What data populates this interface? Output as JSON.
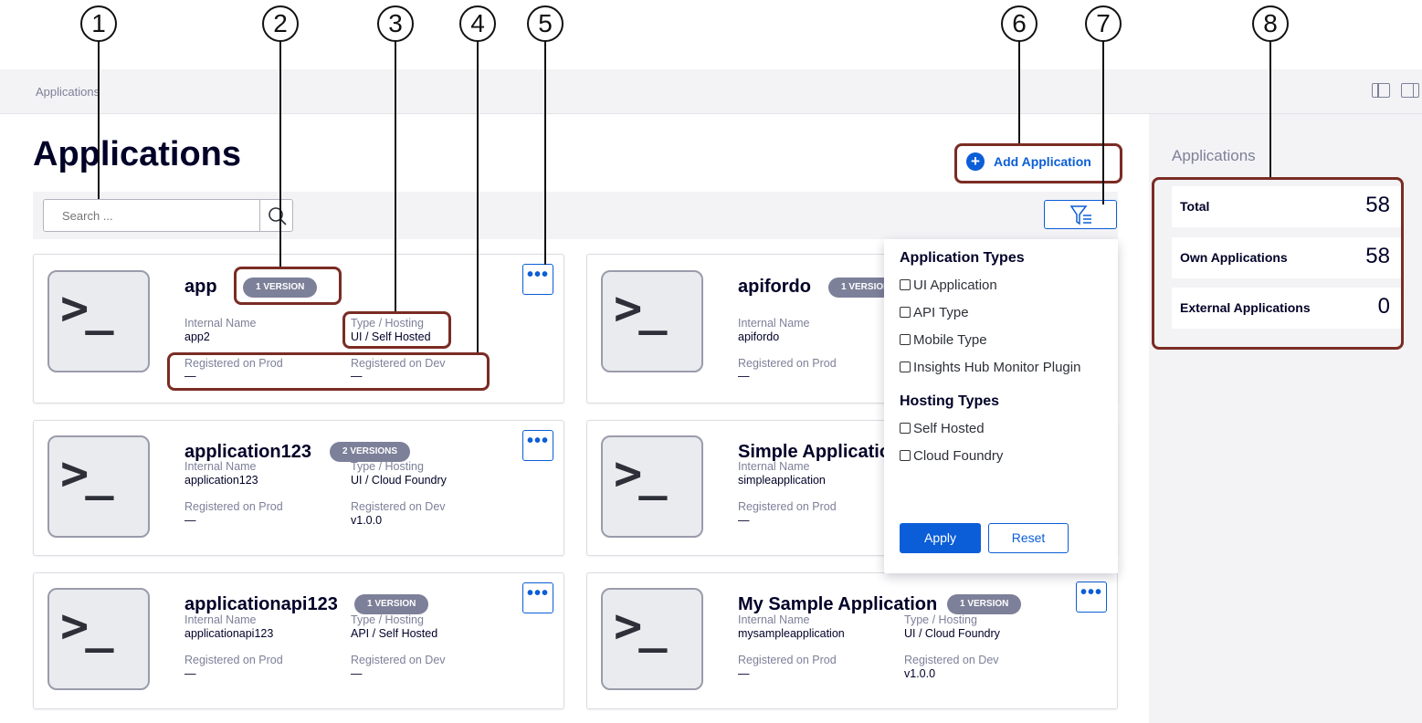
{
  "breadcrumb": "Applications",
  "page_title": "Applications",
  "add_button_label": "Add Application",
  "search": {
    "placeholder": "Search ..."
  },
  "callouts": [
    "1",
    "2",
    "3",
    "4",
    "5",
    "6",
    "7",
    "8"
  ],
  "cards": [
    {
      "name": "app",
      "badge": "1 VERSION",
      "internal_name_label": "Internal Name",
      "internal_name": "app2",
      "type_label": "Type / Hosting",
      "type": "UI / Self Hosted",
      "prod_label": "Registered on Prod",
      "prod": "—",
      "dev_label": "Registered on Dev",
      "dev": "—"
    },
    {
      "name": "apifordo",
      "badge": "1 VERSION",
      "internal_name_label": "Internal Name",
      "internal_name": "apifordo",
      "prod_label": "Registered on Prod",
      "prod": "—"
    },
    {
      "name": "application123",
      "badge": "2 VERSIONS",
      "internal_name_label": "Internal Name",
      "internal_name": "application123",
      "type_label": "Type / Hosting",
      "type": "UI / Cloud Foundry",
      "prod_label": "Registered on Prod",
      "prod": "—",
      "dev_label": "Registered on Dev",
      "dev": "v1.0.0"
    },
    {
      "name": "Simple Application",
      "internal_name_label": "Internal Name",
      "internal_name": "simpleapplication",
      "prod_label": "Registered on Prod",
      "prod": "—"
    },
    {
      "name": "applicationapi123",
      "badge": "1 VERSION",
      "internal_name_label": "Internal Name",
      "internal_name": "applicationapi123",
      "type_label": "Type / Hosting",
      "type": "API / Self Hosted",
      "prod_label": "Registered on Prod",
      "prod": "—",
      "dev_label": "Registered on Dev",
      "dev": "—"
    },
    {
      "name": "My Sample Application",
      "badge": "1 VERSION",
      "internal_name_label": "Internal Name",
      "internal_name": "mysampleapplication",
      "type_label": "Type / Hosting",
      "type": "UI / Cloud Foundry",
      "prod_label": "Registered on Prod",
      "prod": "—",
      "dev_label": "Registered on Dev",
      "dev": "v1.0.0"
    }
  ],
  "card_icon": ">_",
  "more_button": "•••",
  "filter": {
    "app_types_heading": "Application Types",
    "app_types": [
      "UI Application",
      "API Type",
      "Mobile Type",
      "Insights Hub Monitor Plugin"
    ],
    "hosting_heading": "Hosting Types",
    "hosting_types": [
      "Self Hosted",
      "Cloud Foundry"
    ],
    "apply_label": "Apply",
    "reset_label": "Reset"
  },
  "sidebar": {
    "title": "Applications",
    "stats": [
      {
        "label": "Total",
        "value": "58"
      },
      {
        "label": "Own Applications",
        "value": "58"
      },
      {
        "label": "External Applications",
        "value": "0"
      }
    ]
  },
  "colors": {
    "accent": "#0b5ed7",
    "highlight": "#7a2c24",
    "badge": "#7d8099"
  }
}
